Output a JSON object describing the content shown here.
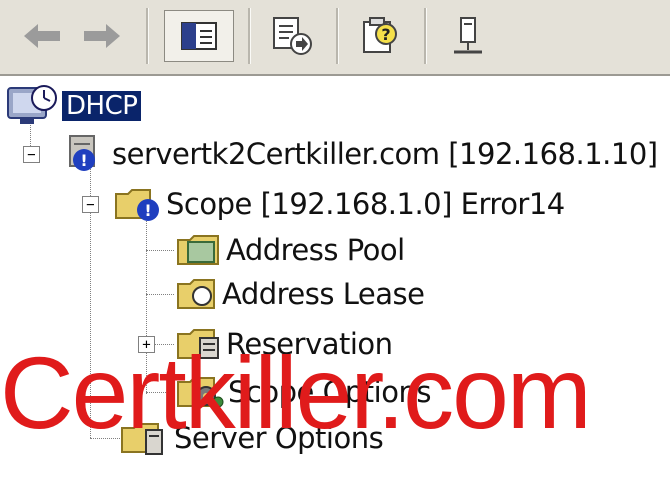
{
  "toolbar": {
    "buttons": [
      {
        "name": "back-button",
        "icon": "back-arrow-icon"
      },
      {
        "name": "forward-button",
        "icon": "forward-arrow-icon"
      },
      {
        "name": "show-hide-console-tree-button",
        "icon": "console-tree-icon"
      },
      {
        "name": "export-list-button",
        "icon": "export-list-icon"
      },
      {
        "name": "help-button",
        "icon": "help-icon"
      },
      {
        "name": "server-connect-button",
        "icon": "connect-icon"
      }
    ]
  },
  "tree": {
    "root": "DHCP",
    "server": "servertk2Certkiller.com [192.168.1.10]",
    "scope": "Scope [192.168.1.0] Error14",
    "address_pool": "Address Pool",
    "address_lease": "Address Lease",
    "reservation": "Reservation",
    "scope_options": "Scope Options",
    "server_options": "Server Options"
  },
  "watermark": "Certkiller.com",
  "colors": {
    "selection": "#0a246a",
    "watermark": "#e01b1b",
    "error": "#1f3fbf",
    "folder": "#e8cf6a"
  }
}
